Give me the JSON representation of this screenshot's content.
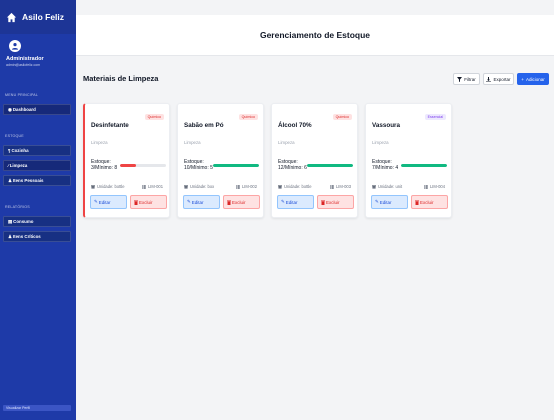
{
  "app": {
    "name": "Asilo Feliz"
  },
  "user": {
    "role": "Administrador",
    "email": "admin@asilofeliz.com"
  },
  "sidebar": {
    "sections": [
      {
        "title": "MENU PRINCIPAL",
        "items": [
          {
            "label": "Dashboard",
            "icon": "dashboard-icon"
          }
        ]
      },
      {
        "title": "ESTOQUE",
        "items": [
          {
            "label": "Cozinha",
            "icon": "utensils-icon"
          },
          {
            "label": "Limpeza",
            "icon": "broom-icon"
          },
          {
            "label": "Itens Pessoais",
            "icon": "users-icon"
          }
        ]
      },
      {
        "title": "RELATÓRIOS",
        "items": [
          {
            "label": "Consumo",
            "icon": "chart-icon"
          },
          {
            "label": "Itens Críticos",
            "icon": "users-icon"
          }
        ]
      }
    ],
    "footer": "Visualizar Perfil"
  },
  "header": {
    "title": "Gerenciamento de Estoque"
  },
  "section": {
    "title": "Materiais de Limpeza"
  },
  "toolbar": {
    "filter_label": "Filtrar",
    "export_label": "Exportar",
    "add_label": "Adicionar"
  },
  "colors": {
    "sidebar": "#1e3aa8",
    "primary": "#2563eb",
    "danger": "#ef4444",
    "success": "#10b981",
    "critical": "#ef4444",
    "ok": "#10b981"
  },
  "items": [
    {
      "name": "Desinfetante",
      "category": "Limpeza",
      "badge": "Químico",
      "badge_type": "quimico",
      "stock_label": "Estoque:",
      "stock_values": "3/Mínimo: 8",
      "stock": 3,
      "minimum": 8,
      "level": 0.35,
      "status": "critical",
      "unit": "Unidade: bottle",
      "code": "LIM-001",
      "edit_label": "Editar",
      "delete_label": "Excluir"
    },
    {
      "name": "Sabão em Pó",
      "category": "Limpeza",
      "badge": "Químico",
      "badge_type": "quimico",
      "stock_label": "Estoque:",
      "stock_values": "10/Mínimo: 5",
      "stock": 10,
      "minimum": 5,
      "level": 1.0,
      "status": "ok",
      "unit": "Unidade: box",
      "code": "LIM-002",
      "edit_label": "Editar",
      "delete_label": "Excluir"
    },
    {
      "name": "Álcool 70%",
      "category": "Limpeza",
      "badge": "Químico",
      "badge_type": "quimico",
      "stock_label": "Estoque:",
      "stock_values": "12/Mínimo: 6",
      "stock": 12,
      "minimum": 6,
      "level": 1.0,
      "status": "ok",
      "unit": "Unidade: bottle",
      "code": "LIM-003",
      "edit_label": "Editar",
      "delete_label": "Excluir"
    },
    {
      "name": "Vassoura",
      "category": "Limpeza",
      "badge": "Essencial",
      "badge_type": "essencial",
      "stock_label": "Estoque:",
      "stock_values": "7/Mínimo: 4",
      "stock": 7,
      "minimum": 4,
      "level": 1.0,
      "status": "ok",
      "unit": "Unidade: unit",
      "code": "LIM-004",
      "edit_label": "Editar",
      "delete_label": "Excluir"
    }
  ]
}
